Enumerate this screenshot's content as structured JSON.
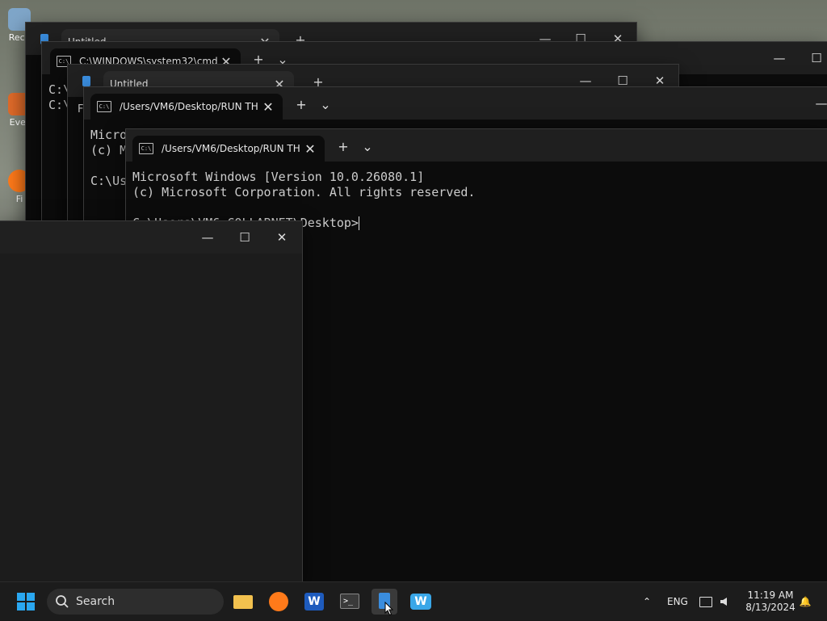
{
  "desktop": {
    "icons": [
      {
        "label": "Recy"
      },
      {
        "label": "Ever"
      },
      {
        "label": "Fi"
      }
    ]
  },
  "windows": {
    "back_notepad": {
      "tab_title": "Untitled"
    },
    "cmd_window": {
      "tab_title": "C:\\WINDOWS\\system32\\cmd.",
      "prompt_a": "C:\\",
      "prompt_b": "C:\\"
    },
    "mid_notepad": {
      "tab_title": "Untitled",
      "menu_char": "F"
    },
    "run_terminal_1": {
      "tab_title": "/Users/VM6/Desktop/RUN TH",
      "line1": "Micro",
      "line2": "(c) M",
      "line3": "C:\\Us"
    },
    "run_terminal_2": {
      "tab_title": "/Users/VM6/Desktop/RUN TH",
      "line1": "Microsoft Windows [Version 10.0.26080.1]",
      "line2": "(c) Microsoft Corporation. All rights reserved.",
      "prompt": "C:\\Users\\VM6.COLLABNET\\Desktop>"
    }
  },
  "glyphs": {
    "close": "✕",
    "minimize": "—",
    "maximize": "☐",
    "new_tab": "+",
    "dropdown": "⌄",
    "tray_chevron": "⌃",
    "bell": "🔔",
    "terminal_icon_text": "C:\\"
  },
  "taskbar": {
    "search_placeholder": "Search",
    "lang": "ENG",
    "time": "11:19 AM",
    "date": "8/13/2024"
  },
  "colors": {
    "start": "#2aa7f0",
    "explorer": "#f2c14e",
    "firefox": "#ff7a1a",
    "word": "#1e5bbd",
    "widget": "#3aa7e8"
  }
}
